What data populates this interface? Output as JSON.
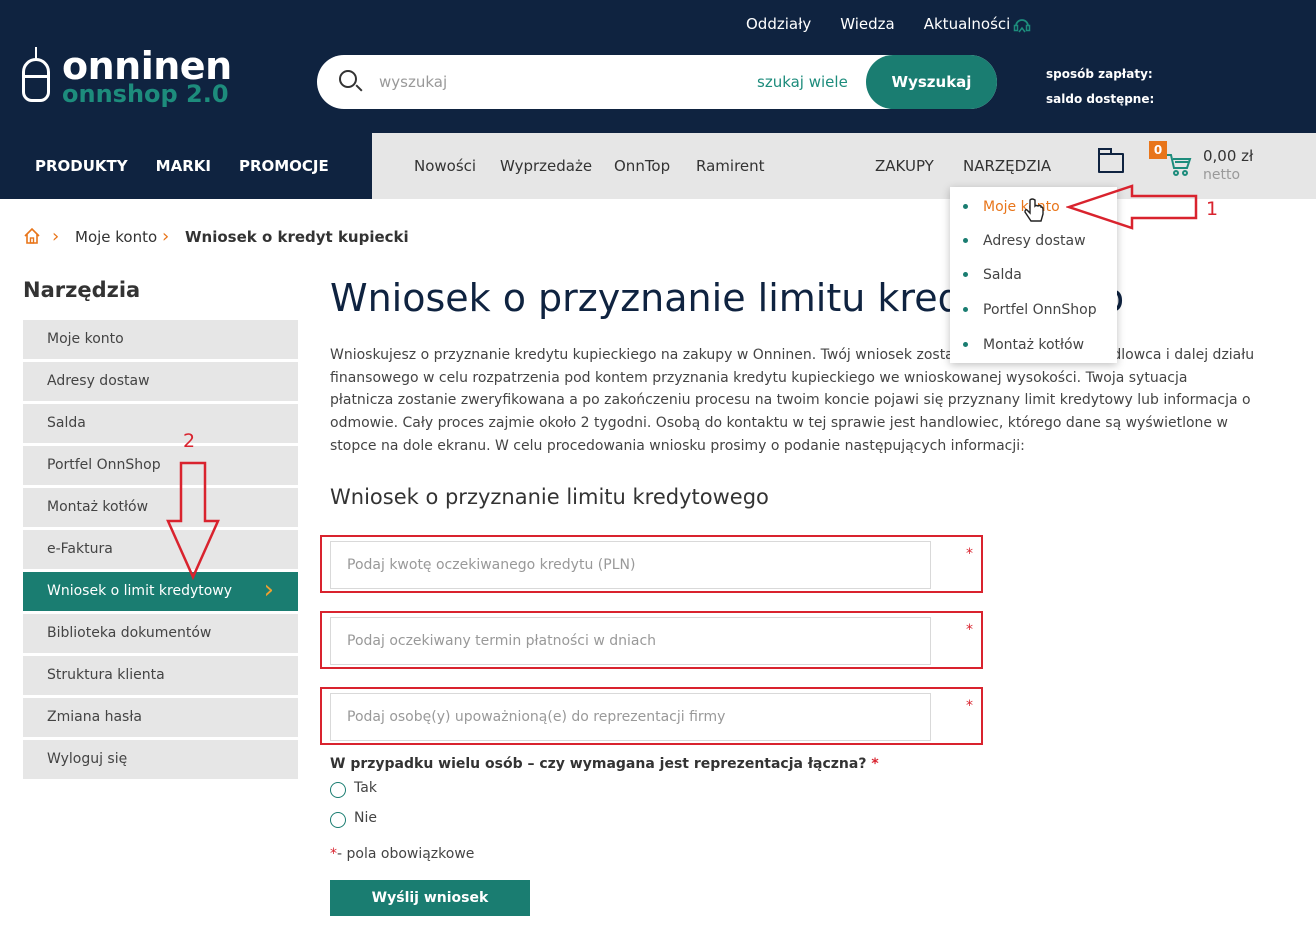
{
  "header": {
    "top_links": [
      "Oddziały",
      "Wiedza",
      "Aktualności"
    ],
    "logo_main": "onninen",
    "logo_sub": "onnshop 2.0",
    "search_placeholder": "wyszukaj",
    "search_many": "szukaj wiele",
    "search_button": "Wyszukaj",
    "payment_method_label": "sposób zapłaty:",
    "balance_label": "saldo dostępne:"
  },
  "nav": {
    "primary": [
      "PRODUKTY",
      "MARKI",
      "PROMOCJE"
    ],
    "secondary": [
      "Nowości",
      "Wyprzedaże",
      "OnnTop",
      "Ramirent"
    ],
    "right": [
      "ZAKUPY",
      "NARZĘDZIA"
    ],
    "cart_count": "0",
    "cart_total": "0,00 zł",
    "cart_net": "netto"
  },
  "dropdown": {
    "items": [
      "Moje konto",
      "Adresy dostaw",
      "Salda",
      "Portfel OnnShop",
      "Montaż kotłów"
    ],
    "active_color": "#e8751a"
  },
  "breadcrumb": {
    "items": [
      "Moje konto",
      "Wniosek o kredyt kupiecki"
    ]
  },
  "sidebar": {
    "title": "Narzędzia",
    "items": [
      "Moje konto",
      "Adresy dostaw",
      "Salda",
      "Portfel OnnShop",
      "Montaż kotłów",
      "e-Faktura",
      "Wniosek o limit kredytowy",
      "Biblioteka dokumentów",
      "Struktura klienta",
      "Zmiana hasła",
      "Wyloguj się"
    ],
    "active_index": 6
  },
  "main": {
    "title": "Wniosek o przyznanie limitu kredytowego",
    "intro": "Wnioskujesz o przyznanie kredytu kupieckiego na zakupy w Onninen. Twój wniosek zostanie przekazany do handlowca i dalej działu finansowego w celu rozpatrzenia pod kontem przyznania kredytu kupieckiego we wnioskowanej wysokości. Twoja sytuacja płatnicza zostanie zweryfikowana a po zakończeniu procesu na twoim koncie pojawi się przyznany limit kredytowy lub informacja o odmowie. Cały proces zajmie około 2 tygodni. Osobą do kontaktu w tej sprawie jest handlowiec, którego dane są wyświetlone w stopce na dole ekranu. W celu procedowania wniosku prosimy o podanie następujących informacji:",
    "form_title": "Wniosek o przyznanie limitu kredytowego",
    "fields": [
      "Podaj kwotę oczekiwanego kredytu (PLN)",
      "Podaj oczekiwany termin płatności w dniach",
      "Podaj osobę(y) upoważnioną(e) do reprezentacji firmy"
    ],
    "question": "W przypadku wielu osób – czy wymagana jest reprezentacja łączna?",
    "options": [
      "Tak",
      "Nie"
    ],
    "required_note": "- pola obowiązkowe",
    "required_star": "*",
    "submit": "Wyślij wniosek"
  },
  "annotations": {
    "label_1": "1",
    "label_2": "2",
    "color": "#d9232e"
  },
  "colors": {
    "navy": "#0f2340",
    "teal": "#1a7d71",
    "orange": "#e8751a"
  }
}
